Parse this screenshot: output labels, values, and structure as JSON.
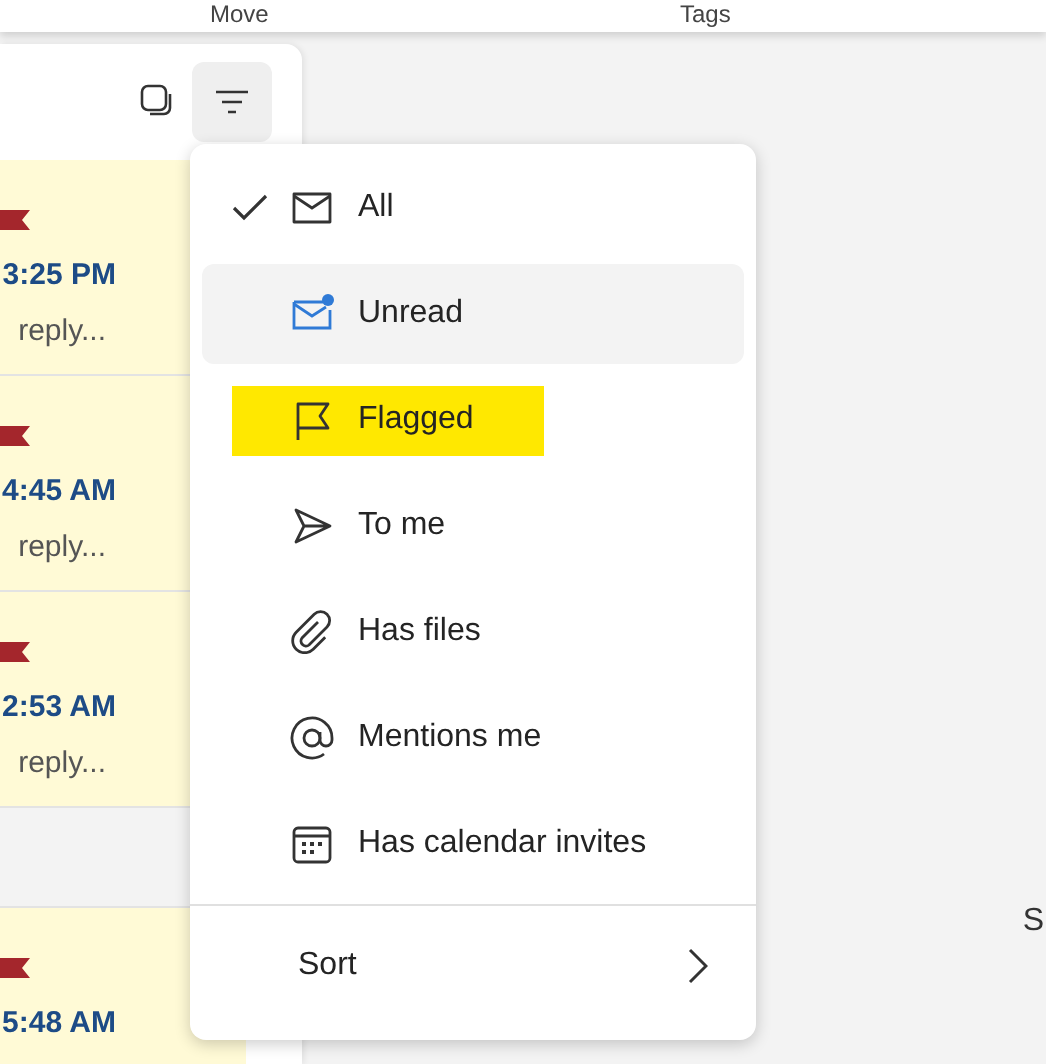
{
  "ribbon": [
    {
      "label": "Move"
    },
    {
      "label": "Tags"
    }
  ],
  "messages": [
    {
      "flagged": true,
      "time": "3:25 PM",
      "preview": "reply..."
    },
    {
      "flagged": true,
      "time": "4:45 AM",
      "preview": "reply..."
    },
    {
      "flagged": true,
      "time": "2:53 AM",
      "preview": "reply..."
    },
    {
      "flagged": true,
      "time": "5:48 AM"
    }
  ],
  "filter_menu": {
    "items": [
      {
        "label": "All",
        "checked": true,
        "hovered": false,
        "highlighted": false
      },
      {
        "label": "Unread",
        "checked": false,
        "hovered": true,
        "highlighted": false
      },
      {
        "label": "Flagged",
        "checked": false,
        "hovered": false,
        "highlighted": true
      },
      {
        "label": "To me",
        "checked": false,
        "hovered": false,
        "highlighted": false
      },
      {
        "label": "Has files",
        "checked": false,
        "hovered": false,
        "highlighted": false
      },
      {
        "label": "Mentions me",
        "checked": false,
        "hovered": false,
        "highlighted": false
      },
      {
        "label": "Has calendar invites",
        "checked": false,
        "hovered": false,
        "highlighted": false
      }
    ],
    "sort": {
      "label": "Sort"
    }
  },
  "reading_pane": {
    "text": "S"
  }
}
